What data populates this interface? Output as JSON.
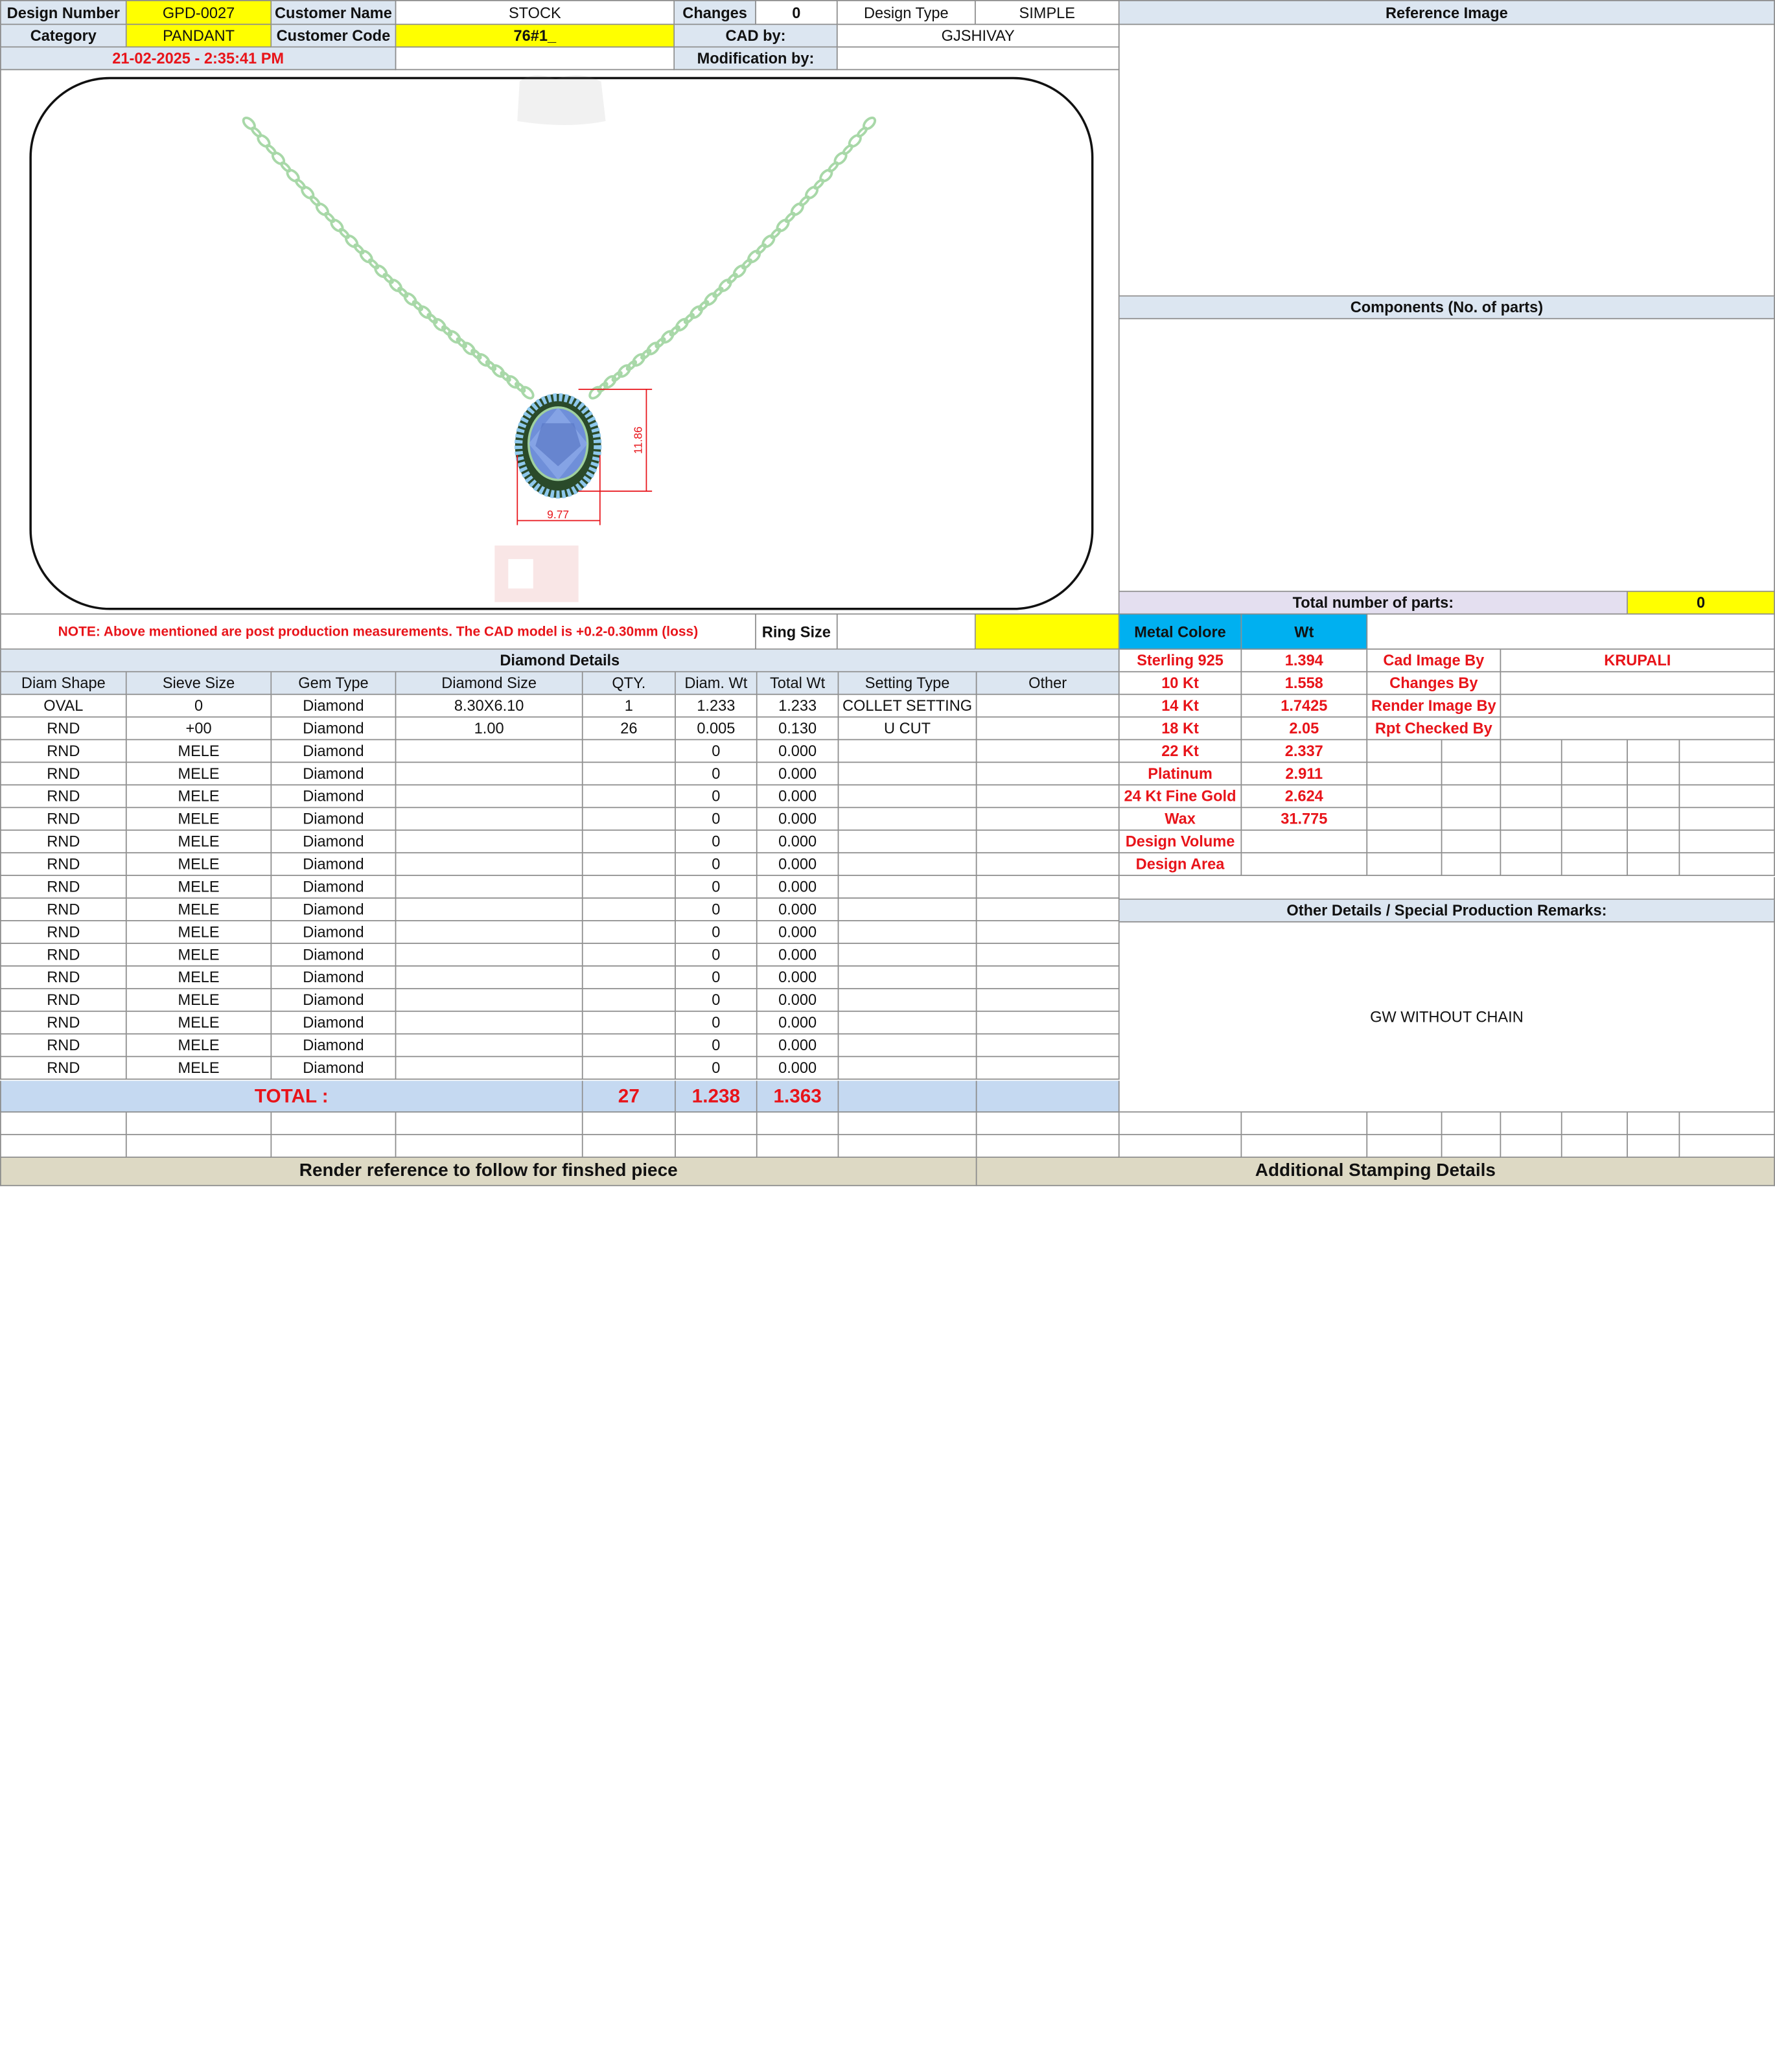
{
  "header": {
    "design_number_label": "Design Number",
    "design_number": "GPD-0027",
    "customer_name_label": "Customer Name",
    "customer_name": "STOCK",
    "changes_label": "Changes",
    "changes": "0",
    "design_type_label": "Design Type",
    "design_type": "SIMPLE",
    "category_label": "Category",
    "category": "PANDANT",
    "customer_code_label": "Customer Code",
    "customer_code": "76#1_",
    "cad_by_label": "CAD by:",
    "cad_by": "GJSHIVAY",
    "date": "21-02-2025 - 2:35:41 PM",
    "modification_by_label": "Modification by:",
    "modification_by": ""
  },
  "drawing": {
    "height_dim": "11.86",
    "width_dim": "9.77",
    "chain_color": "#a8d8a8",
    "stone_color": "#6f8fd9",
    "halo_color": "#8ec8ec"
  },
  "right_panel": {
    "reference_image_label": "Reference Image",
    "components_label": "Components (No. of parts)",
    "total_parts_label": "Total number of parts:",
    "total_parts": "0",
    "metal_colore_label": "Metal Colore",
    "wt_label": "Wt",
    "metals": [
      {
        "name": "Sterling 925",
        "wt": "1.394"
      },
      {
        "name": "10 Kt",
        "wt": "1.558"
      },
      {
        "name": "14 Kt",
        "wt": "1.7425"
      },
      {
        "name": "18 Kt",
        "wt": "2.05"
      },
      {
        "name": "22 Kt",
        "wt": "2.337"
      },
      {
        "name": "Platinum",
        "wt": "2.911"
      },
      {
        "name": "24 Kt Fine Gold",
        "wt": "2.624"
      },
      {
        "name": "Wax",
        "wt": "31.775"
      },
      {
        "name": "Design Volume",
        "wt": ""
      },
      {
        "name": "Design Area",
        "wt": ""
      }
    ],
    "credits": [
      {
        "label": "Cad Image By",
        "value": "KRUPALI"
      },
      {
        "label": "Changes By",
        "value": ""
      },
      {
        "label": "Render Image By",
        "value": ""
      },
      {
        "label": "Rpt Checked By",
        "value": ""
      }
    ],
    "other_details_label": "Other Details / Special Production Remarks:",
    "other_details": "GW WITHOUT CHAIN",
    "additional_stamping_label": "Additional Stamping Details"
  },
  "note": "NOTE: Above mentioned are post production measurements. The CAD model is +0.2-0.30mm (loss)",
  "ring_size_label": "Ring Size",
  "ring_size": "",
  "diamond_details": {
    "title": "Diamond Details",
    "columns": [
      "Diam Shape",
      "Sieve Size",
      "Gem Type",
      "Diamond Size",
      "QTY.",
      "Diam. Wt",
      "Total Wt",
      "Setting Type",
      "Other"
    ],
    "rows": [
      [
        "OVAL",
        "0",
        "Diamond",
        "8.30X6.10",
        "1",
        "1.233",
        "1.233",
        "COLLET SETTING",
        ""
      ],
      [
        "RND",
        "+00",
        "Diamond",
        "1.00",
        "26",
        "0.005",
        "0.130",
        "U CUT",
        ""
      ],
      [
        "RND",
        "MELE",
        "Diamond",
        "",
        "",
        "0",
        "0.000",
        "",
        ""
      ],
      [
        "RND",
        "MELE",
        "Diamond",
        "",
        "",
        "0",
        "0.000",
        "",
        ""
      ],
      [
        "RND",
        "MELE",
        "Diamond",
        "",
        "",
        "0",
        "0.000",
        "",
        ""
      ],
      [
        "RND",
        "MELE",
        "Diamond",
        "",
        "",
        "0",
        "0.000",
        "",
        ""
      ],
      [
        "RND",
        "MELE",
        "Diamond",
        "",
        "",
        "0",
        "0.000",
        "",
        ""
      ],
      [
        "RND",
        "MELE",
        "Diamond",
        "",
        "",
        "0",
        "0.000",
        "",
        ""
      ],
      [
        "RND",
        "MELE",
        "Diamond",
        "",
        "",
        "0",
        "0.000",
        "",
        ""
      ],
      [
        "RND",
        "MELE",
        "Diamond",
        "",
        "",
        "0",
        "0.000",
        "",
        ""
      ],
      [
        "RND",
        "MELE",
        "Diamond",
        "",
        "",
        "0",
        "0.000",
        "",
        ""
      ],
      [
        "RND",
        "MELE",
        "Diamond",
        "",
        "",
        "0",
        "0.000",
        "",
        ""
      ],
      [
        "RND",
        "MELE",
        "Diamond",
        "",
        "",
        "0",
        "0.000",
        "",
        ""
      ],
      [
        "RND",
        "MELE",
        "Diamond",
        "",
        "",
        "0",
        "0.000",
        "",
        ""
      ],
      [
        "RND",
        "MELE",
        "Diamond",
        "",
        "",
        "0",
        "0.000",
        "",
        ""
      ],
      [
        "RND",
        "MELE",
        "Diamond",
        "",
        "",
        "0",
        "0.000",
        "",
        ""
      ],
      [
        "RND",
        "MELE",
        "Diamond",
        "",
        "",
        "0",
        "0.000",
        "",
        ""
      ]
    ],
    "total_label": "TOTAL :",
    "total_qty": "27",
    "total_diam_wt": "1.238",
    "total_wt": "1.363"
  },
  "render_reference_label": "Render reference to follow for finshed piece"
}
